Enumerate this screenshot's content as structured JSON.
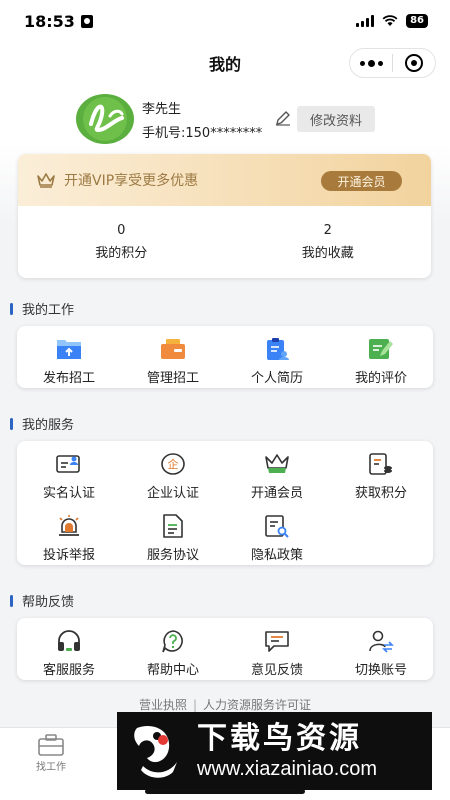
{
  "status_bar": {
    "time": "18:53",
    "battery": "86"
  },
  "nav": {
    "title": "我的"
  },
  "user": {
    "name": "李先生",
    "phone": "手机号:150********",
    "edit_label": "修改资料"
  },
  "vip": {
    "text": "开通VIP享受更多优惠",
    "button": "开通会员"
  },
  "stats": [
    {
      "value": "0",
      "label": "我的积分"
    },
    {
      "value": "2",
      "label": "我的收藏"
    }
  ],
  "sections": {
    "work": {
      "title": "我的工作",
      "items": [
        {
          "label": "发布招工",
          "icon": "upload-folder-icon"
        },
        {
          "label": "管理招工",
          "icon": "briefcase-icon"
        },
        {
          "label": "个人简历",
          "icon": "resume-icon"
        },
        {
          "label": "我的评价",
          "icon": "review-icon"
        }
      ]
    },
    "service": {
      "title": "我的服务",
      "items": [
        {
          "label": "实名认证",
          "icon": "id-card-icon"
        },
        {
          "label": "企业认证",
          "icon": "enterprise-icon"
        },
        {
          "label": "开通会员",
          "icon": "crown-icon"
        },
        {
          "label": "获取积分",
          "icon": "points-icon"
        },
        {
          "label": "投诉举报",
          "icon": "alarm-icon"
        },
        {
          "label": "服务协议",
          "icon": "document-icon"
        },
        {
          "label": "隐私政策",
          "icon": "privacy-icon"
        }
      ]
    },
    "help": {
      "title": "帮助反馈",
      "items": [
        {
          "label": "客服服务",
          "icon": "headset-icon"
        },
        {
          "label": "帮助中心",
          "icon": "help-icon"
        },
        {
          "label": "意见反馈",
          "icon": "feedback-icon"
        },
        {
          "label": "切换账号",
          "icon": "switch-account-icon"
        }
      ]
    }
  },
  "footer": {
    "license": "营业执照",
    "divider": "|",
    "permit": "人力资源服务许可证"
  },
  "tabbar": {
    "tab1_label": "找工作"
  },
  "watermark": {
    "title": "下载鸟资源",
    "url": "www.xiazainiao.com"
  },
  "colors": {
    "accent": "#2c64c4",
    "vip_gold": "#a87a3c",
    "brand_green": "#5aaf3e"
  }
}
